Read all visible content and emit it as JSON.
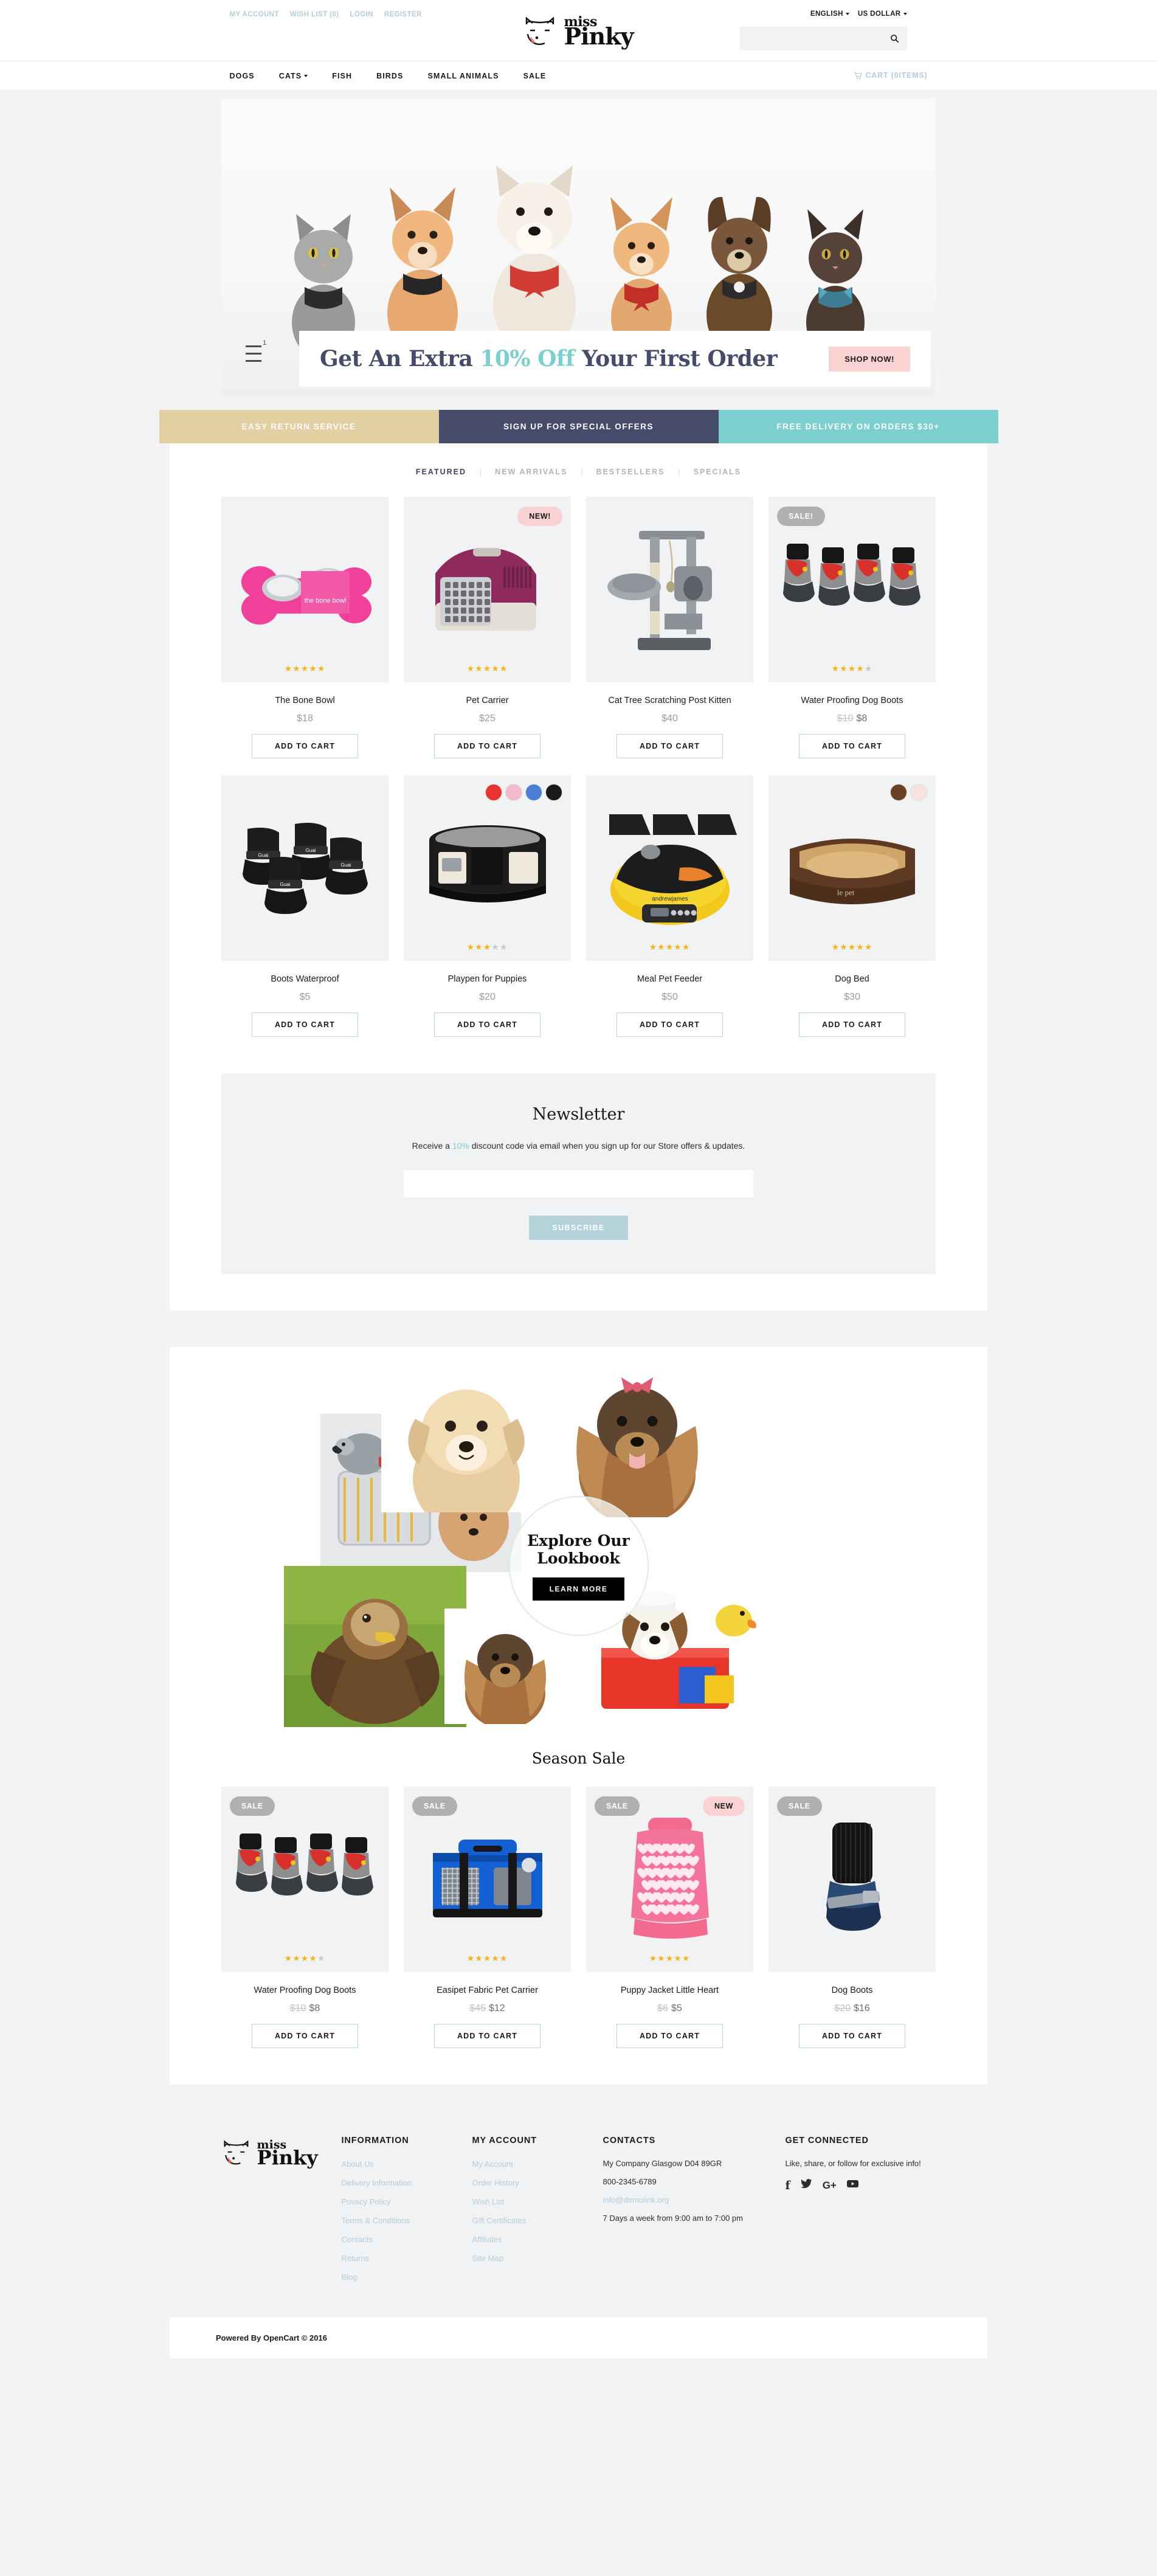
{
  "topbar": {
    "links": [
      {
        "label": "MY ACCOUNT"
      },
      {
        "label": "WISH LIST (0)"
      },
      {
        "label": "LOGIN"
      },
      {
        "label": "REGISTER"
      }
    ],
    "language": "ENGLISH",
    "currency": "US DOLLAR",
    "logo_miss": "miss",
    "logo_pinky": "Pinky",
    "search_placeholder": "",
    "search_value": "",
    "search_icon": "search-icon"
  },
  "nav": {
    "items": [
      {
        "label": "DOGS",
        "has_dropdown": false
      },
      {
        "label": "CATS",
        "has_dropdown": true
      },
      {
        "label": "FISH",
        "has_dropdown": false
      },
      {
        "label": "BIRDS",
        "has_dropdown": false
      },
      {
        "label": "SMALL ANIMALS",
        "has_dropdown": false
      },
      {
        "label": "SALE",
        "has_dropdown": false
      }
    ],
    "cart_label": "CART (0items)",
    "cart_icon": "cart-icon"
  },
  "hero": {
    "headline_pre": "Get An Extra ",
    "headline_accent": "10% Off",
    "headline_post": " Your First Order",
    "cta": "SHOP NOW!",
    "slide_number": "1"
  },
  "promos": [
    {
      "label": "EASY RETURN SERVICE",
      "color": "#e2cfa2"
    },
    {
      "label": "SIGN UP FOR SPECIAL OFFERS",
      "color": "#464b69"
    },
    {
      "label": "FREE DELIVERY ON ORDERS $30+",
      "color": "#7ccfcf"
    }
  ],
  "tabs": [
    {
      "label": "FEATURED",
      "active": true
    },
    {
      "label": "NEW ARRIVALS",
      "active": false
    },
    {
      "label": "BESTSELLERS",
      "active": false
    },
    {
      "label": "SPECIALS",
      "active": false
    }
  ],
  "add_to_cart_label": "ADD TO CART",
  "featured_products": [
    {
      "title": "The Bone Bowl",
      "price": "$18",
      "old_price": "",
      "stars": 5,
      "badge": "",
      "badge_type": "",
      "swatches": []
    },
    {
      "title": "Pet Carrier",
      "price": "$25",
      "old_price": "",
      "stars": 5,
      "badge": "NEW!",
      "badge_type": "new",
      "swatches": []
    },
    {
      "title": "Cat Tree Scratching Post Kitten",
      "price": "$40",
      "old_price": "",
      "stars": 0,
      "badge": "",
      "badge_type": "",
      "swatches": []
    },
    {
      "title": "Water Proofing Dog Boots",
      "price": "$8",
      "old_price": "$10",
      "stars": 4,
      "badge": "SALE!",
      "badge_type": "sale",
      "swatches": []
    },
    {
      "title": "Boots Waterproof",
      "price": "$5",
      "old_price": "",
      "stars": 0,
      "badge": "",
      "badge_type": "",
      "swatches": []
    },
    {
      "title": "Playpen for Puppies",
      "price": "$20",
      "old_price": "",
      "stars": 3,
      "badge": "",
      "badge_type": "",
      "swatches": [
        "#e8332f",
        "#f2b9cf",
        "#4a7fd4",
        "#1a1a1a"
      ]
    },
    {
      "title": "Meal Pet Feeder",
      "price": "$50",
      "old_price": "",
      "stars": 5,
      "badge": "",
      "badge_type": "",
      "swatches": []
    },
    {
      "title": "Dog Bed",
      "price": "$30",
      "old_price": "",
      "stars": 5,
      "badge": "",
      "badge_type": "",
      "swatches": [
        "#6b4125",
        "#f6e3dd"
      ]
    }
  ],
  "newsletter": {
    "title": "Newsletter",
    "sub_pre": "Receive a ",
    "sub_accent": "10%",
    "sub_post": " discount code via email when you sign up for our Store offers & updates.",
    "input_value": "",
    "input_placeholder": "",
    "button": "SUBSCRIBE"
  },
  "lookbook": {
    "title_line1": "Explore Our",
    "title_line2": "Lookbook",
    "button": "LEARN MORE"
  },
  "season": {
    "title": "Season Sale",
    "products": [
      {
        "title": "Water Proofing Dog Boots",
        "price": "$8",
        "old_price": "$10",
        "stars": 4,
        "badge": "SALE",
        "badge_type": "sale",
        "badge2": "",
        "swatches": []
      },
      {
        "title": "Easipet Fabric Pet Carrier",
        "price": "$12",
        "old_price": "$45",
        "stars": 5,
        "badge": "SALE",
        "badge_type": "sale",
        "badge2": "",
        "swatches": []
      },
      {
        "title": "Puppy Jacket Little Heart",
        "price": "$5",
        "old_price": "$6",
        "stars": 5,
        "badge": "SALE",
        "badge_type": "sale",
        "badge2": "NEW",
        "swatches": []
      },
      {
        "title": "Dog Boots",
        "price": "$16",
        "old_price": "$20",
        "stars": 0,
        "badge": "SALE",
        "badge_type": "sale",
        "badge2": "",
        "swatches": []
      }
    ]
  },
  "footer": {
    "logo_miss": "miss",
    "logo_pinky": "Pinky",
    "information": {
      "heading": "INFORMATION",
      "items": [
        {
          "label": "About Us"
        },
        {
          "label": "Delivery Information"
        },
        {
          "label": "Privacy Policy"
        },
        {
          "label": "Terms & Conditions"
        },
        {
          "label": "Contacts"
        },
        {
          "label": "Returns"
        },
        {
          "label": "Blog"
        }
      ]
    },
    "my_account": {
      "heading": "MY ACCOUNT",
      "items": [
        {
          "label": "My Account"
        },
        {
          "label": "Order History"
        },
        {
          "label": "Wish List"
        },
        {
          "label": "Gift Certificates"
        },
        {
          "label": "Affiliates"
        },
        {
          "label": "Site Map"
        }
      ]
    },
    "contacts": {
      "heading": "CONTACTS",
      "address": "My Company Glasgow D04 89GR",
      "phone": "800-2345-6789",
      "email": "info@demolink.org",
      "hours": "7 Days a week from 9:00 am to 7:00 pm"
    },
    "connected": {
      "heading": "GET CONNECTED",
      "text": "Like, share, or follow for exclusive info!",
      "socials": [
        {
          "name": "facebook-icon",
          "glyph": "f"
        },
        {
          "name": "twitter-icon",
          "glyph": "✉"
        },
        {
          "name": "google-plus-icon",
          "glyph": "G+"
        },
        {
          "name": "youtube-icon",
          "glyph": "▶"
        }
      ]
    },
    "copyright": "Powered By OpenCart © 2016"
  },
  "colors": {
    "accent_teal": "#7ccfcf",
    "navy": "#464b69",
    "tan": "#e2cfa2",
    "pink": "#fbd2d2",
    "link_blue": "#b6ccd8",
    "star": "#f4b41a"
  }
}
